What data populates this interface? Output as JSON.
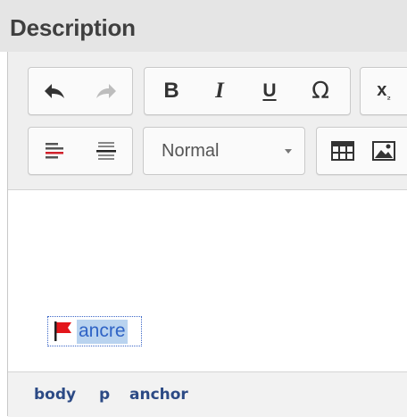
{
  "header": {
    "title": "Description"
  },
  "toolbar": {
    "format_value": "Normal",
    "glyphs": {
      "bold": "B",
      "italic": "I",
      "underline": "U",
      "special_char": "Ω",
      "subscript": "x",
      "subscript_small": "₂"
    }
  },
  "content": {
    "anchor_text": "ancre"
  },
  "statusbar": {
    "path": [
      "body",
      "p",
      "anchor"
    ]
  },
  "colors": {
    "header_bg": "#e5e5e5",
    "toolbar_bg": "#efefef",
    "selection": "#b9d3ef",
    "anchor_text": "#2f63c5",
    "flag": "#e3161b",
    "path_text": "#2c4a85"
  }
}
